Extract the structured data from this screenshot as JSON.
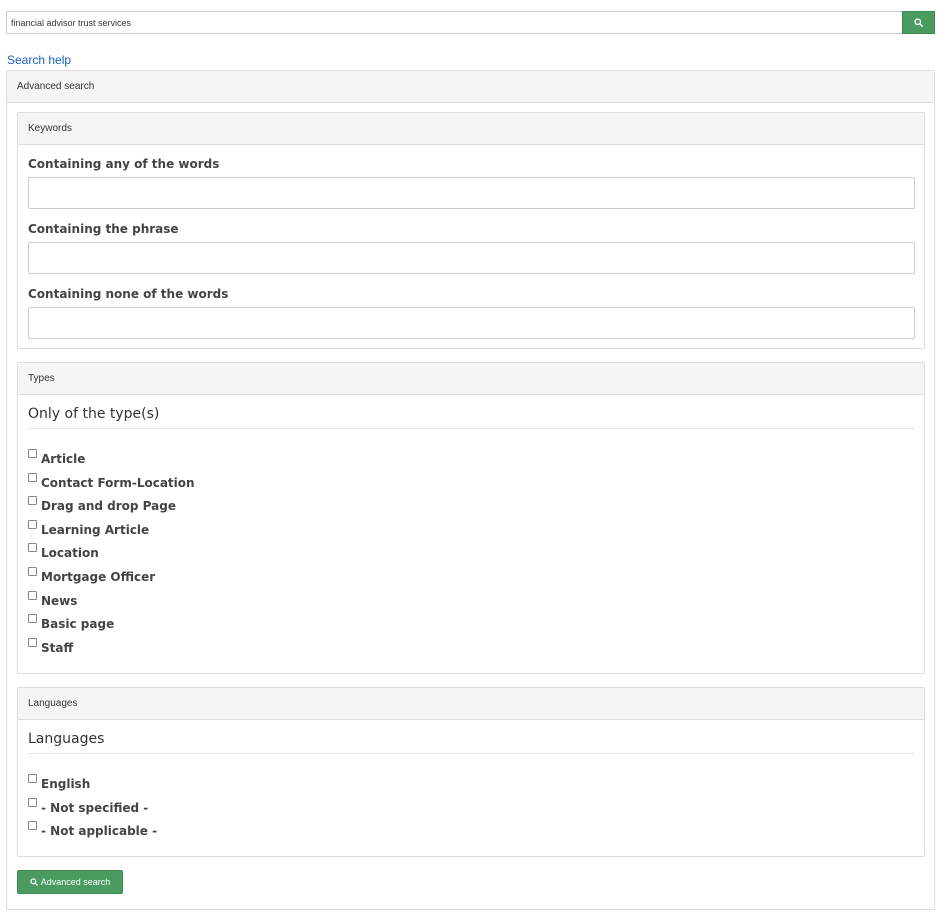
{
  "search": {
    "value": "financial advisor trust services",
    "button_icon": "search-icon"
  },
  "help_link": "Search help",
  "advanced": {
    "title": "Advanced search",
    "keywords": {
      "title": "Keywords",
      "any_label": "Containing any of the words",
      "any_value": "",
      "phrase_label": "Containing the phrase",
      "phrase_value": "",
      "none_label": "Containing none of the words",
      "none_value": ""
    },
    "types": {
      "title": "Types",
      "legend": "Only of the type(s)",
      "options": [
        "Article",
        "Contact Form-Location",
        "Drag and drop Page",
        "Learning Article",
        "Location",
        "Mortgage Officer",
        "News",
        "Basic page",
        "Staff"
      ]
    },
    "languages": {
      "title": "Languages",
      "legend": "Languages",
      "options": [
        "English",
        "- Not specified -",
        "- Not applicable -"
      ]
    },
    "submit_label": "Advanced search",
    "accent_color": "#4a9b5f",
    "link_color": "#1a5fc4"
  }
}
